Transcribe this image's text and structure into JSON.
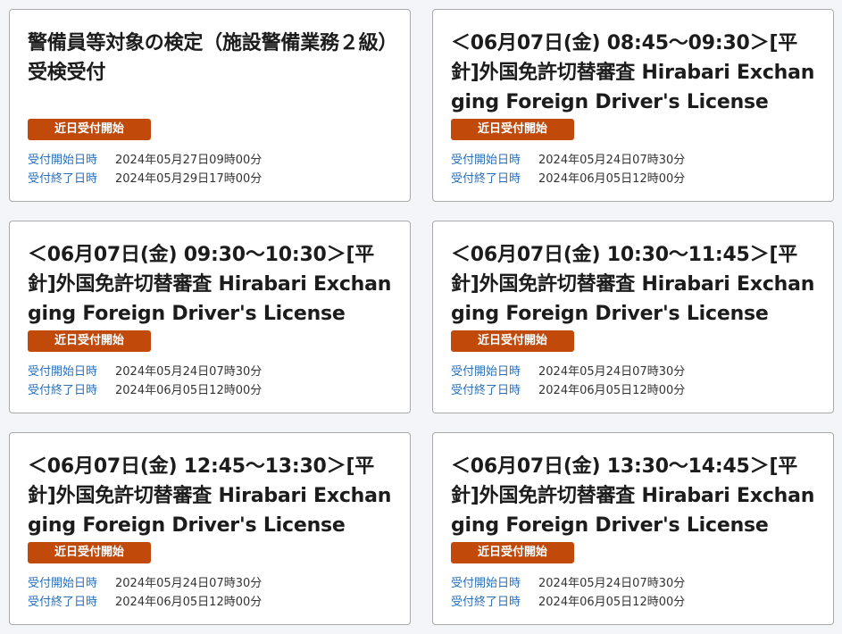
{
  "colors": {
    "badge_background": "#c14a0b",
    "label_color": "#2a6fb7",
    "card_border": "#a9a9a9"
  },
  "labels": {
    "start": "受付開始日時",
    "end": "受付終了日時"
  },
  "cards": [
    {
      "title": "警備員等対象の検定（施設警備業務２級）受検受付",
      "badge": "近日受付開始",
      "start": "2024年05月27日09時00分",
      "end": "2024年05月29日17時00分"
    },
    {
      "title": "＜06月07日(金) 08:45～09:30＞[平針]外国免許切替審査 Hirabari Exchanging Foreign Driver's License",
      "badge": "近日受付開始",
      "start": "2024年05月24日07時30分",
      "end": "2024年06月05日12時00分"
    },
    {
      "title": "＜06月07日(金) 09:30～10:30＞[平針]外国免許切替審査 Hirabari Exchanging Foreign Driver's License",
      "badge": "近日受付開始",
      "start": "2024年05月24日07時30分",
      "end": "2024年06月05日12時00分"
    },
    {
      "title": "＜06月07日(金) 10:30～11:45＞[平針]外国免許切替審査 Hirabari Exchanging Foreign Driver's License",
      "badge": "近日受付開始",
      "start": "2024年05月24日07時30分",
      "end": "2024年06月05日12時00分"
    },
    {
      "title": "＜06月07日(金) 12:45～13:30＞[平針]外国免許切替審査 Hirabari Exchanging Foreign Driver's License",
      "badge": "近日受付開始",
      "start": "2024年05月24日07時30分",
      "end": "2024年06月05日12時00分"
    },
    {
      "title": "＜06月07日(金) 13:30～14:45＞[平針]外国免許切替審査 Hirabari Exchanging Foreign Driver's License",
      "badge": "近日受付開始",
      "start": "2024年05月24日07時30分",
      "end": "2024年06月05日12時00分"
    }
  ]
}
